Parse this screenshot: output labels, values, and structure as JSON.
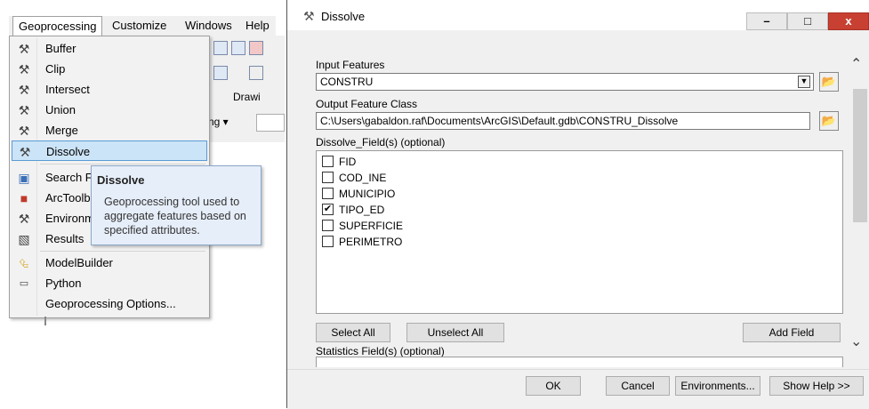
{
  "menubar": {
    "items": [
      "Geoprocessing",
      "Customize",
      "Windows",
      "Help"
    ]
  },
  "toolbar_partial": {
    "drawing_label": "Drawi",
    "dropdown_label": "ng ▾"
  },
  "menu": {
    "items": [
      {
        "label": "Buffer",
        "icon": "hammer-icon"
      },
      {
        "label": "Clip",
        "icon": "hammer-icon"
      },
      {
        "label": "Intersect",
        "icon": "hammer-icon"
      },
      {
        "label": "Union",
        "icon": "hammer-icon"
      },
      {
        "label": "Merge",
        "icon": "hammer-icon"
      },
      {
        "label": "Dissolve",
        "icon": "hammer-icon"
      },
      {
        "label": "Search Fo",
        "icon": "search-window-icon"
      },
      {
        "label": "ArcToolb",
        "icon": "toolbox-icon"
      },
      {
        "label": "Environm",
        "icon": "environments-icon"
      },
      {
        "label": "Results",
        "icon": "results-icon"
      },
      {
        "label": "ModelBuilder",
        "icon": "modelbuilder-icon"
      },
      {
        "label": "Python",
        "icon": "python-icon"
      },
      {
        "label": "Geoprocessing Options...",
        "icon": ""
      }
    ]
  },
  "tooltip": {
    "title": "Dissolve",
    "body": "Geoprocessing tool used to aggregate features based on specified attributes."
  },
  "dialog": {
    "title": "Dissolve",
    "controls": {
      "minimize": "–",
      "maximize": "□",
      "close": "x"
    },
    "input_features_label": "Input Features",
    "input_features_value": "CONSTRU",
    "output_label": "Output Feature Class",
    "output_value": "C:\\Users\\gabaldon.raf\\Documents\\ArcGIS\\Default.gdb\\CONSTRU_Dissolve",
    "dissolve_fields_label": "Dissolve_Field(s) (optional)",
    "fields": [
      {
        "name": "FID",
        "checked": false
      },
      {
        "name": "COD_INE",
        "checked": false
      },
      {
        "name": "MUNICIPIO",
        "checked": false
      },
      {
        "name": "TIPO_ED",
        "checked": true
      },
      {
        "name": "SUPERFICIE",
        "checked": false
      },
      {
        "name": "PERIMETRO",
        "checked": false
      }
    ],
    "select_all": "Select All",
    "unselect_all": "Unselect All",
    "add_field": "Add Field",
    "statistics_label": "Statistics Field(s) (optional)",
    "ok": "OK",
    "cancel": "Cancel",
    "environments": "Environments...",
    "show_help": "Show Help >>"
  }
}
